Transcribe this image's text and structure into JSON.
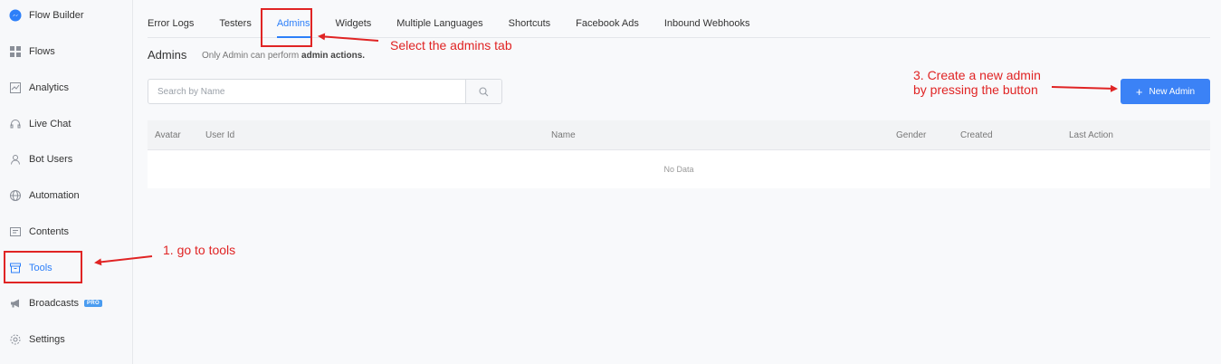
{
  "sidebar": {
    "items": [
      {
        "label": "Flow Builder",
        "icon": "messenger-icon"
      },
      {
        "label": "Flows",
        "icon": "grid-icon"
      },
      {
        "label": "Analytics",
        "icon": "chart-icon"
      },
      {
        "label": "Live Chat",
        "icon": "headset-icon"
      },
      {
        "label": "Bot Users",
        "icon": "user-icon"
      },
      {
        "label": "Automation",
        "icon": "globe-icon"
      },
      {
        "label": "Contents",
        "icon": "document-icon"
      },
      {
        "label": "Tools",
        "icon": "archive-icon",
        "active": true
      },
      {
        "label": "Broadcasts",
        "icon": "megaphone-icon",
        "badge": "PRO"
      },
      {
        "label": "Settings",
        "icon": "gear-icon"
      }
    ]
  },
  "tabs": [
    {
      "label": "Error Logs"
    },
    {
      "label": "Testers"
    },
    {
      "label": "Admins",
      "active": true
    },
    {
      "label": "Widgets"
    },
    {
      "label": "Multiple Languages"
    },
    {
      "label": "Shortcuts"
    },
    {
      "label": "Facebook Ads"
    },
    {
      "label": "Inbound Webhooks"
    }
  ],
  "page": {
    "title": "Admins",
    "subtitle_prefix": "Only Admin can perform",
    "subtitle_bold": "admin actions."
  },
  "search": {
    "placeholder": "Search by Name",
    "value": ""
  },
  "new_admin_button": {
    "label": "New Admin"
  },
  "table": {
    "columns": [
      "Avatar",
      "User Id",
      "Name",
      "Gender",
      "Created",
      "Last Action"
    ],
    "empty_text": "No Data"
  },
  "annotations": {
    "step1": "1. go to tools",
    "step2": "Select the admins tab",
    "step3_line1": "3. Create a new admin",
    "step3_line2": "by pressing the button",
    "color": "#e02424"
  },
  "colors": {
    "accent": "#2d7ff9",
    "button": "#3b82f6"
  }
}
